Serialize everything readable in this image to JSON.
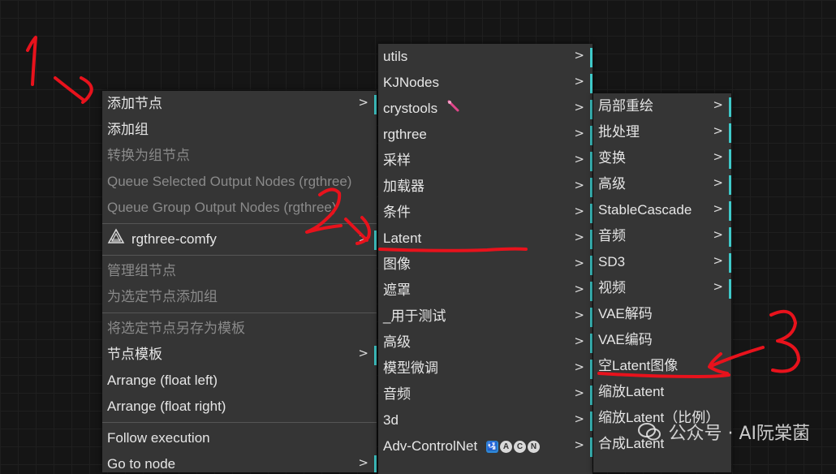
{
  "menu1": {
    "items": [
      {
        "label": "添加节点",
        "disabled": false,
        "submenu": true
      },
      {
        "label": "添加组",
        "disabled": false,
        "submenu": false
      },
      {
        "label": "转换为组节点",
        "disabled": true,
        "submenu": false
      },
      {
        "label": "Queue Selected Output Nodes (rgthree)",
        "disabled": true,
        "submenu": false
      },
      {
        "label": "Queue Group Output Nodes (rgthree)",
        "disabled": true,
        "submenu": false
      },
      {
        "label": "rgthree-comfy",
        "disabled": false,
        "submenu": true,
        "icon": "rgthree-logo-icon"
      },
      {
        "label": "管理组节点",
        "disabled": true,
        "submenu": false
      },
      {
        "label": "为选定节点添加组",
        "disabled": true,
        "submenu": false
      },
      {
        "label": "将选定节点另存为模板",
        "disabled": true,
        "submenu": false
      },
      {
        "label": "节点模板",
        "disabled": false,
        "submenu": true
      },
      {
        "label": "Arrange (float left)",
        "disabled": false,
        "submenu": false
      },
      {
        "label": "Arrange (float right)",
        "disabled": false,
        "submenu": false
      },
      {
        "label": "Follow execution",
        "disabled": false,
        "submenu": false
      },
      {
        "label": "Go to node",
        "disabled": false,
        "submenu": true
      }
    ]
  },
  "menu2": {
    "items": [
      {
        "label": "utils"
      },
      {
        "label": "KJNodes"
      },
      {
        "label": "crystools",
        "icon": "wand-icon"
      },
      {
        "label": "rgthree"
      },
      {
        "label": "采样"
      },
      {
        "label": "加载器"
      },
      {
        "label": "条件"
      },
      {
        "label": "Latent"
      },
      {
        "label": "图像"
      },
      {
        "label": "遮罩"
      },
      {
        "label": "_用于测试"
      },
      {
        "label": "高级"
      },
      {
        "label": "模型微调"
      },
      {
        "label": "音频"
      },
      {
        "label": "3d"
      },
      {
        "label": "Adv-ControlNet",
        "badges": [
          "🛂",
          "A",
          "C",
          "N"
        ]
      }
    ]
  },
  "menu3": {
    "items": [
      {
        "label": "局部重绘",
        "submenu": true
      },
      {
        "label": "批处理",
        "submenu": true
      },
      {
        "label": "变换",
        "submenu": true
      },
      {
        "label": "高级",
        "submenu": true
      },
      {
        "label": "StableCascade",
        "submenu": true
      },
      {
        "label": "音频",
        "submenu": true
      },
      {
        "label": "SD3",
        "submenu": true
      },
      {
        "label": "视频",
        "submenu": true
      },
      {
        "label": "VAE解码",
        "submenu": false
      },
      {
        "label": "VAE编码",
        "submenu": false
      },
      {
        "label": "空Latent图像",
        "submenu": false
      },
      {
        "label": "缩放Latent",
        "submenu": false
      },
      {
        "label": "缩放Latent（比例）",
        "submenu": false
      },
      {
        "label": "合成Latent",
        "submenu": false
      }
    ]
  },
  "submenu_arrow": ">",
  "annotations": {
    "step1": "1",
    "step2": "2",
    "step3": "3",
    "color": "#e8121c"
  },
  "watermark": "公众号 · AI阮棠菌",
  "colors": {
    "menu_bg": "#353535",
    "accent": "#3fc9c9",
    "canvas_bg": "#151515"
  }
}
